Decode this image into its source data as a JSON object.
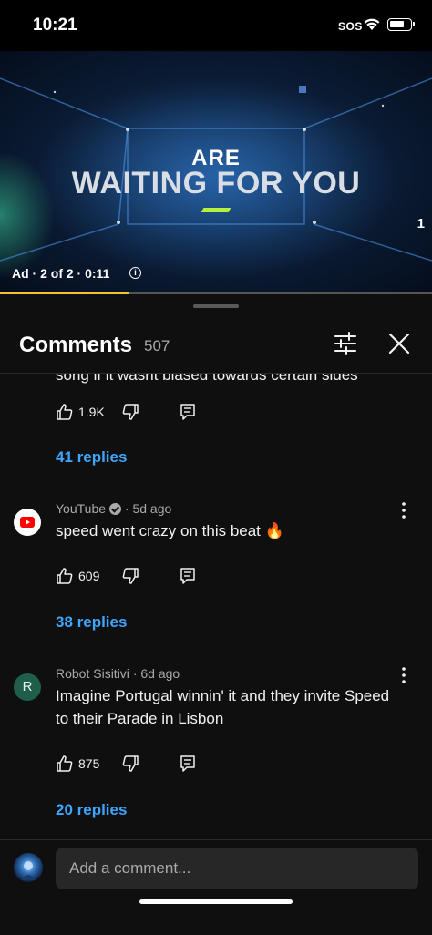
{
  "status_bar": {
    "time": "10:21",
    "sos": "SOS",
    "icons": [
      "wifi-icon",
      "battery-icon"
    ]
  },
  "ad": {
    "line1": "ARE",
    "line2": "WAITING FOR YOU",
    "info": "Ad · 2 of 2 · 0:11",
    "info_icon": "i",
    "counter": "1",
    "progress_fraction": 0.3,
    "accent_color": "#b4f03c"
  },
  "comments_header": {
    "title": "Comments",
    "count": "507",
    "icons": [
      "filter-icon",
      "close-icon"
    ]
  },
  "partial_comment": {
    "text": "song if it wasnt biased towards certain sides",
    "likes": "1.9K",
    "replies_label": "41 replies"
  },
  "comments": [
    {
      "author": "YouTube",
      "verified": true,
      "time": "5d ago",
      "text": "speed went crazy on this beat 🔥",
      "likes": "609",
      "replies_label": "38 replies",
      "avatar": "youtube-logo"
    },
    {
      "author": "Robot Sisitivi",
      "verified": false,
      "time": "6d ago",
      "text": "Imagine Portugal winnin' it and they invite Speed to their Parade in Lisbon",
      "likes": "875",
      "replies_label": "20 replies",
      "avatar_letter": "R"
    }
  ],
  "comment_input": {
    "placeholder": "Add a comment..."
  },
  "colors": {
    "link": "#3ea6ff",
    "background": "#0f0f0f",
    "progress": "#f4c430"
  }
}
